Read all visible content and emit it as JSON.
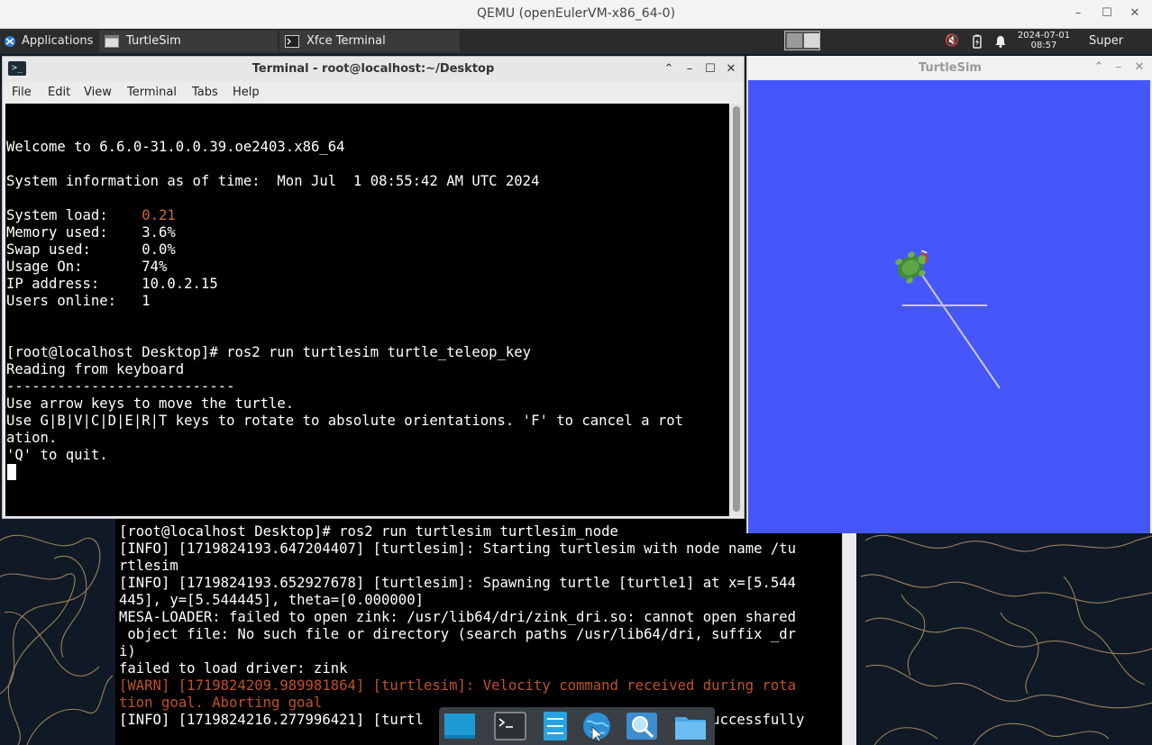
{
  "qemu": {
    "title": "QEMU (openEulerVM-x86_64-0)",
    "minimize": "–",
    "maximize": "☐",
    "close": "✕"
  },
  "panel": {
    "applications": "Applications",
    "tasks": [
      {
        "label": "TurtleSim",
        "icon": "window-icon"
      },
      {
        "label": "Xfce Terminal",
        "icon": "terminal-icon"
      }
    ],
    "clock": {
      "date": "2024-07-01",
      "time": "08:57"
    },
    "user": "Super User"
  },
  "terminal_window": {
    "title": "Terminal - root@localhost:~/Desktop",
    "menu": [
      "File",
      "Edit",
      "View",
      "Terminal",
      "Tabs",
      "Help"
    ],
    "lines": [
      "Welcome to 6.6.0-31.0.0.39.oe2403.x86_64",
      "",
      "System information as of time:  Mon Jul  1 08:55:42 AM UTC 2024",
      "",
      "System load:    ",
      "Memory used:    3.6%",
      "Swap used:      0.0%",
      "Usage On:       74%",
      "IP address:     10.0.2.15",
      "Users online:   1",
      "",
      "",
      "[root@localhost Desktop]# ros2 run turtlesim turtle_teleop_key",
      "Reading from keyboard",
      "---------------------------",
      "Use arrow keys to move the turtle.",
      "Use G|B|V|C|D|E|R|T keys to rotate to absolute orientations. 'F' to cancel a rot",
      "ation.",
      "'Q' to quit."
    ],
    "system_load_value": "0.21"
  },
  "turtlesim_window": {
    "title": "TurtleSim",
    "background_color": "#4557fb",
    "pen_color": "#c8c8c8"
  },
  "background_terminal": {
    "lines_before_warn": [
      "[root@localhost Desktop]# ros2 run turtlesim turtlesim_node",
      "[INFO] [1719824193.647204407] [turtlesim]: Starting turtlesim with node name /tu",
      "rtlesim",
      "[INFO] [1719824193.652927678] [turtlesim]: Spawning turtle [turtle1] at x=[5.544",
      "445], y=[5.544445], theta=[0.000000]",
      "MESA-LOADER: failed to open zink: /usr/lib64/dri/zink_dri.so: cannot open shared",
      " object file: No such file or directory (search paths /usr/lib64/dri, suffix _dr",
      "i)",
      "failed to load driver: zink"
    ],
    "warn_lines": [
      "[WARN] [1719824209.989981864] [turtlesim]: Velocity command received during rota",
      "tion goal. Aborting goal"
    ],
    "last_line": "[INFO] [1719824216.277996421] [turtl                                 successfully"
  },
  "dock": {
    "items": [
      "show-desktop-icon",
      "terminal-icon",
      "file-manager-icon",
      "web-browser-icon",
      "app-finder-icon",
      "folder-icon"
    ]
  }
}
